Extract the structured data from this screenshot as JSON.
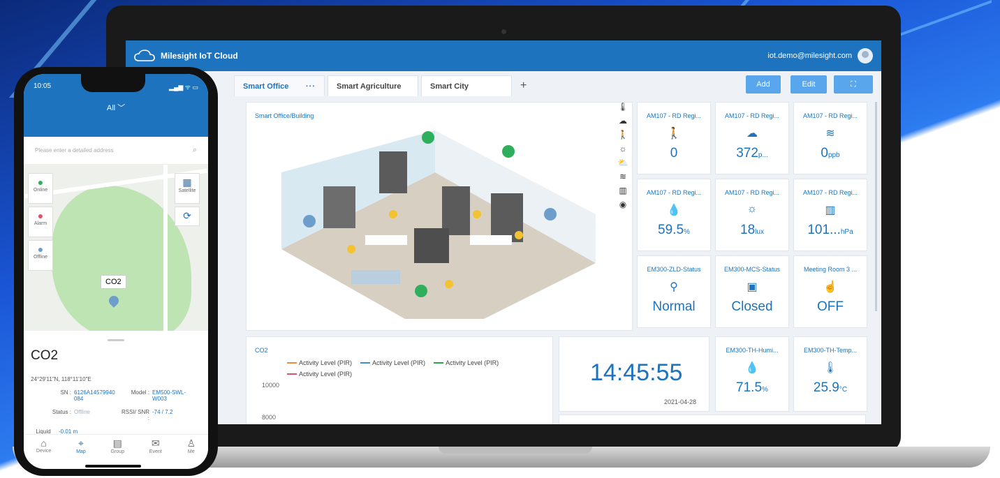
{
  "laptop": {
    "brand": "Milesight IoT Cloud",
    "user_email": "iot.demo@milesight.com",
    "tabs": [
      {
        "label": "Smart Office",
        "more": "···"
      },
      {
        "label": "Smart Agriculture"
      },
      {
        "label": "Smart City"
      }
    ],
    "add_tab": "+",
    "buttons": {
      "add": "Add",
      "edit": "Edit",
      "fullscreen": "⛶"
    },
    "floorplan_title": "Smart Office/Building",
    "side_icons": [
      "🌡",
      "☁",
      "🚶",
      "☼",
      "⛅",
      "≋",
      "▥",
      "◉"
    ],
    "tiles": [
      {
        "name": "AM107 - RD Regi...",
        "icon": "🚶",
        "value": "0",
        "unit": ""
      },
      {
        "name": "AM107 - RD Regi...",
        "icon": "☁",
        "value": "372",
        "unit": "p..."
      },
      {
        "name": "AM107 - RD Regi...",
        "icon": "≋",
        "value": "0",
        "unit": "ppb"
      },
      {
        "name": "AM107 - RD Regi...",
        "icon": "💧",
        "value": "59.5",
        "unit": "%"
      },
      {
        "name": "AM107 - RD Regi...",
        "icon": "☼",
        "value": "18",
        "unit": "lux"
      },
      {
        "name": "AM107 - RD Regi...",
        "icon": "▥",
        "value": "101...",
        "unit": "hPa"
      },
      {
        "name": "EM300-ZLD-Status",
        "icon": "⚲",
        "value": "Normal",
        "unit": ""
      },
      {
        "name": "EM300-MCS-Status",
        "icon": "▣",
        "value": "Closed",
        "unit": ""
      },
      {
        "name": "Meeting Room 3 ...",
        "icon": "☝",
        "value": "OFF",
        "unit": ""
      }
    ],
    "chart": {
      "title": "CO2",
      "legend": [
        "Activity Level (PIR)",
        "Activity Level (PIR)",
        "Activity Level (PIR)",
        "Activity Level (PIR)"
      ],
      "legend_colors": [
        "#f08a3c",
        "#3c8fd6",
        "#2aa44a",
        "#e0526a"
      ],
      "y_ticks": [
        "10000",
        "8000"
      ]
    },
    "clock": {
      "time": "14:45:55",
      "date": "2021-04-28"
    },
    "small_tiles": [
      {
        "name": "EM300-TH-Humi...",
        "icon": "💧",
        "value": "71.5",
        "unit": "%"
      },
      {
        "name": "EM300-TH-Temp...",
        "icon": "🌡",
        "value": "25.9",
        "unit": "°C"
      }
    ]
  },
  "phone": {
    "time": "10:05",
    "status": "▂▄▆ ᯤ ▭",
    "filter": "All ﹀",
    "search_placeholder": "Please enter a detailed address",
    "map_buttons": {
      "online": "Online",
      "alarm": "Alarm",
      "offline": "Offline",
      "satellite": "Satellite"
    },
    "callout": "CO2",
    "detail": {
      "title": "CO2",
      "coords": "24°29'11\"N, 118°11'10\"E",
      "sn_label": "SN :",
      "sn_value": "6126A14579940 084",
      "model_label": "Model :",
      "model_value": "EM500-SWL-W003",
      "status_label": "Status :",
      "status_value": "Offline",
      "rssi_label": "RSSI/ SNR :",
      "rssi_value": "-74 / 7.2",
      "level_label": "Liquid Level :",
      "level_value": "-0.01 m"
    },
    "nav": [
      {
        "label": "Device",
        "icon": "⌂"
      },
      {
        "label": "Map",
        "icon": "⌖"
      },
      {
        "label": "Group",
        "icon": "▤"
      },
      {
        "label": "Event",
        "icon": "✉"
      },
      {
        "label": "Me",
        "icon": "♙"
      }
    ]
  }
}
